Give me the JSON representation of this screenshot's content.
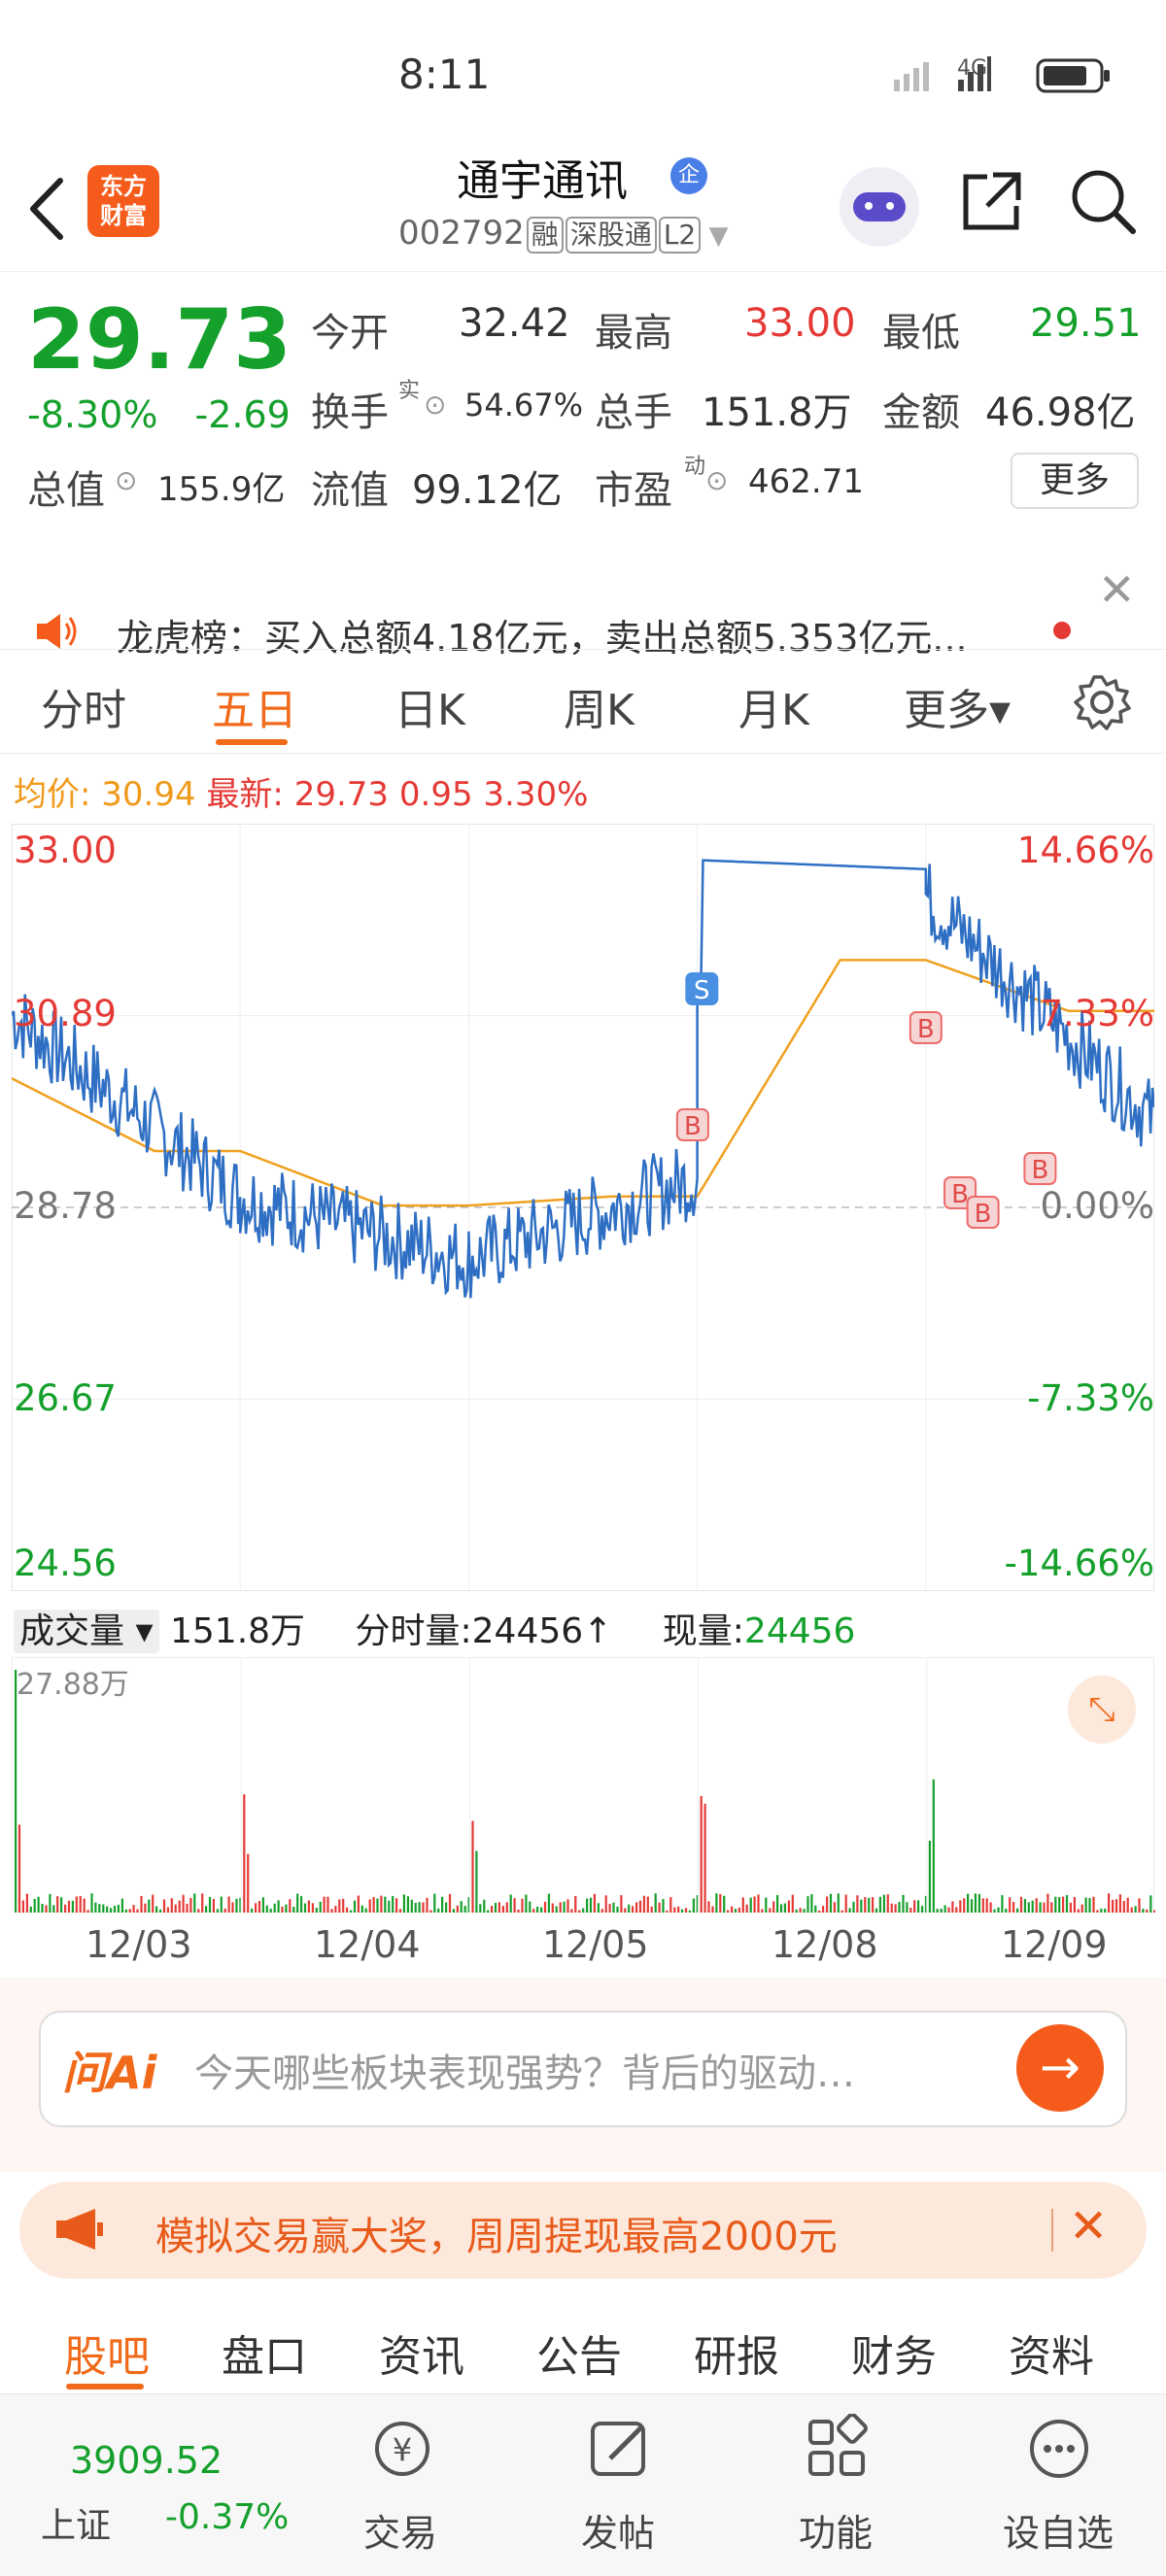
{
  "status_bar": {
    "time": "8:11",
    "network": "4G"
  },
  "header": {
    "back_icon": "back-arrow-icon",
    "logo_text": [
      "东方",
      "财富"
    ],
    "title": "通宇通讯",
    "title_badge": "企",
    "code": "002792",
    "tags": [
      "融",
      "深股通",
      "L2"
    ],
    "share_icon": "share-icon",
    "search_icon": "search-icon"
  },
  "quote": {
    "price": "29.73",
    "change_pct": "-8.30%",
    "change_amt": "-2.69",
    "open_label": "今开",
    "open": "32.42",
    "high_label": "最高",
    "high": "33.00",
    "low_label": "最低",
    "low": "29.51",
    "turnover_label": "换手",
    "turnover_sup": "实",
    "turnover": "54.67%",
    "volume_label": "总手",
    "volume": "151.8万",
    "amount_label": "金额",
    "amount": "46.98亿",
    "mktcap_label": "总值",
    "mktcap": "155.9亿",
    "float_label": "流值",
    "float": "99.12亿",
    "pe_label": "市盈",
    "pe_sup": "动",
    "pe": "462.71",
    "more": "更多"
  },
  "notice": {
    "text": "龙虎榜：买入总额4.18亿元，卖出总额5.353亿元..."
  },
  "tabs": [
    "分时",
    "五日",
    "日K",
    "周K",
    "月K",
    "更多▾"
  ],
  "active_tab": "五日",
  "avg_bar": {
    "avg_label": "均价:",
    "avg": "30.94",
    "last_label": "最新:",
    "last": "29.73",
    "chg": "0.95",
    "pct": "3.30%"
  },
  "chart_data": {
    "type": "line",
    "title": "",
    "x": [
      "12/03",
      "12/04",
      "12/05",
      "12/08",
      "12/09"
    ],
    "y_left_ticks": [
      "33.00",
      "30.89",
      "28.78",
      "26.67",
      "24.56"
    ],
    "y_right_ticks": [
      "14.66%",
      "7.33%",
      "0.00%",
      "-7.33%",
      "-14.66%"
    ],
    "ylim": [
      24.56,
      33.0
    ],
    "series": [
      {
        "name": "",
        "values_per_day_close": [
          28.9,
          28.2,
          29.1,
          32.2,
          29.73
        ]
      },
      {
        "name": "均价",
        "values_per_day_close": [
          29.4,
          28.8,
          28.9,
          31.5,
          30.94
        ]
      }
    ],
    "markers": [
      "B",
      "S",
      "B",
      "B",
      "B",
      "B"
    ],
    "volume": {
      "label": "成交量",
      "total": "151.8万",
      "tick_label": "分时量:24456↑",
      "now_label": "现量:",
      "now": "24456",
      "max": "27.88万"
    }
  },
  "ai": {
    "logo": "问Ai",
    "placeholder": "今天哪些板块表现强势？背后的驱动…"
  },
  "promo": {
    "text": "模拟交易赢大奖，周周提现最高2000元"
  },
  "bottom_tabs": [
    "股吧",
    "盘口",
    "资讯",
    "公告",
    "研报",
    "财务",
    "资料"
  ],
  "bottom_nav": {
    "index_value": "3909.52",
    "index_name": "上证",
    "index_pct": "-0.37%",
    "items": [
      "交易",
      "发帖",
      "功能",
      "设自选"
    ]
  }
}
